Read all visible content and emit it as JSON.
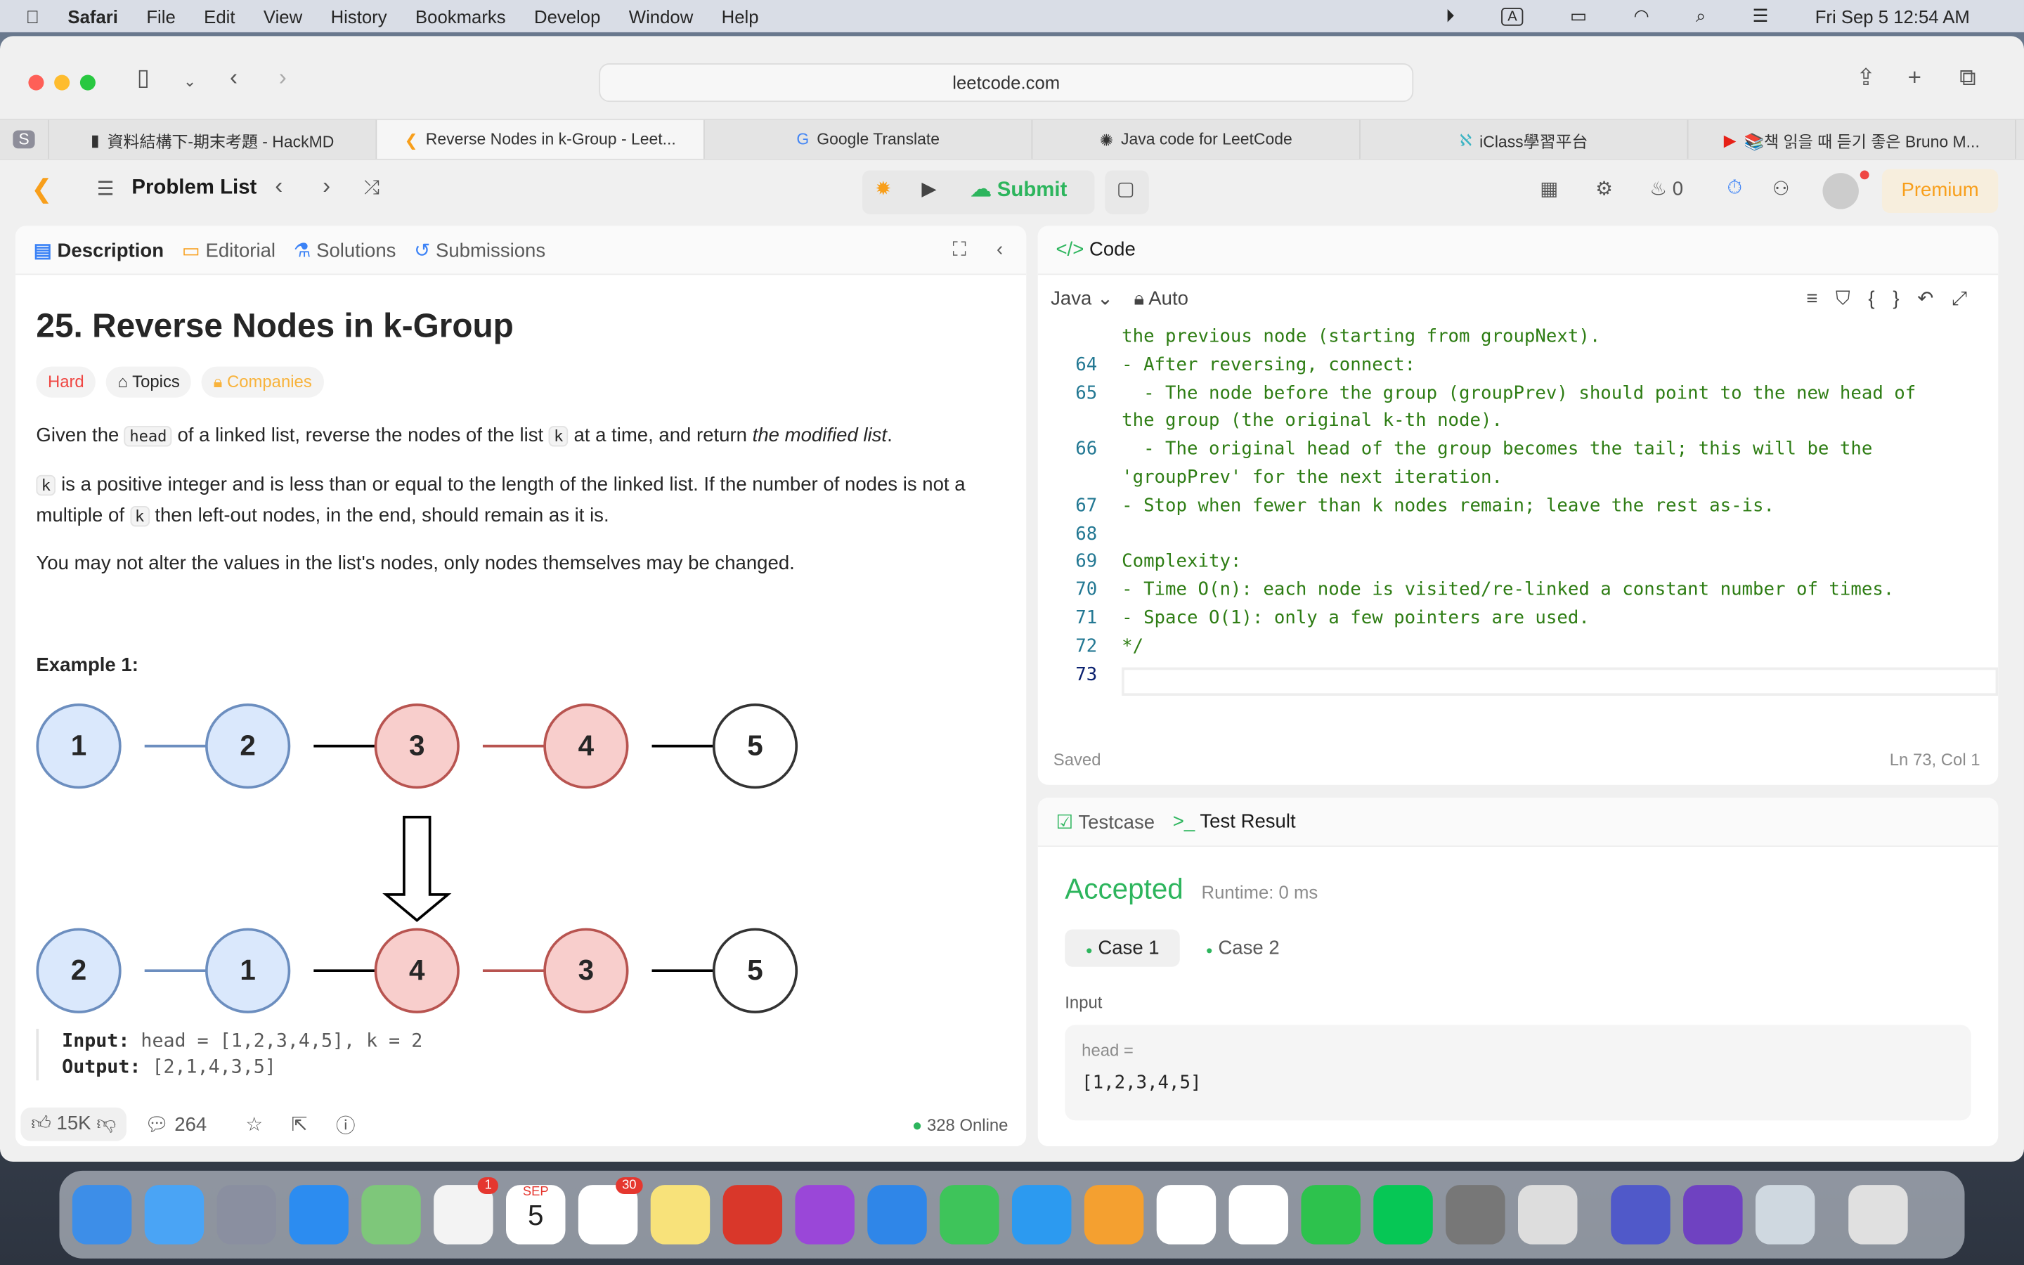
{
  "menubar": {
    "app": "Safari",
    "items": [
      "File",
      "Edit",
      "View",
      "History",
      "Bookmarks",
      "Develop",
      "Window",
      "Help"
    ],
    "clock": "Fri Sep 5  12:54 AM",
    "input_indicator": "A"
  },
  "browser": {
    "url": "leetcode.com",
    "tabs": [
      {
        "label": "S"
      },
      {
        "label": "資料結構下-期末考題 - HackMD"
      },
      {
        "label": "Reverse Nodes in k-Group - Leet..."
      },
      {
        "label": "Google Translate"
      },
      {
        "label": "Java code for LeetCode"
      },
      {
        "label": "iClass學習平台"
      },
      {
        "label": "📚책 읽을 때 듣기 좋은 Bruno M..."
      }
    ]
  },
  "lc": {
    "problem_list": "Problem List",
    "submit": "Submit",
    "fire_count": "0",
    "premium": "Premium"
  },
  "desc": {
    "tabs": [
      "Description",
      "Editorial",
      "Solutions",
      "Submissions"
    ],
    "title": "25. Reverse Nodes in k-Group",
    "difficulty": "Hard",
    "topics": "Topics",
    "companies": "Companies",
    "p1": [
      "Given the ",
      "head",
      " of a linked list, reverse the nodes of the list ",
      "k",
      " at a time, and return ",
      "the modified list",
      "."
    ],
    "p2": [
      "k",
      " is a positive integer and is less than or equal to the length of the linked list. If the number of nodes is not a multiple of ",
      "k",
      " then left-out nodes, in the end, should remain as it is."
    ],
    "p3": "You may not alter the values in the list's nodes, only nodes themselves may be changed.",
    "example": "Example 1:",
    "row1": [
      "1",
      "2",
      "3",
      "4",
      "5"
    ],
    "row2": [
      "2",
      "1",
      "4",
      "3",
      "5"
    ],
    "input_label": "Input:",
    "input": "head = [1,2,3,4,5], k = 2",
    "output_label": "Output:",
    "output": "[2,1,4,3,5]",
    "likes": "15K",
    "comments": "264",
    "online": "328 Online"
  },
  "code": {
    "title": "Code",
    "lang": "Java",
    "mode": "Auto",
    "status": "Saved",
    "cursor": "Ln 73, Col 1",
    "lines": [
      {
        "n": "",
        "t": "the previous node (starting from groupNext)."
      },
      {
        "n": "64",
        "t": "- After reversing, connect:"
      },
      {
        "n": "65",
        "t": "  - The node before the group (groupPrev) should point to the new head of"
      },
      {
        "n": "",
        "t": "the group (the original k-th node)."
      },
      {
        "n": "66",
        "t": "  - The original head of the group becomes the tail; this will be the"
      },
      {
        "n": "",
        "t": "'groupPrev' for the next iteration."
      },
      {
        "n": "67",
        "t": "- Stop when fewer than k nodes remain; leave the rest as-is."
      },
      {
        "n": "68",
        "t": ""
      },
      {
        "n": "69",
        "t": "Complexity:"
      },
      {
        "n": "70",
        "t": "- Time O(n): each node is visited/re-linked a constant number of times."
      },
      {
        "n": "71",
        "t": "- Space O(1): only a few pointers are used."
      },
      {
        "n": "72",
        "t": "*/"
      },
      {
        "n": "73",
        "t": ""
      }
    ]
  },
  "test": {
    "tabs": [
      "Testcase",
      "Test Result"
    ],
    "status": "Accepted",
    "runtime": "Runtime: 0 ms",
    "cases": [
      "Case 1",
      "Case 2"
    ],
    "input_label": "Input",
    "var": "head =",
    "value": "[1,2,3,4,5]"
  },
  "dock": {
    "badges": {
      "photos": "1",
      "calendar_month": "SEP",
      "calendar_day": "5",
      "reminders": "30"
    }
  }
}
